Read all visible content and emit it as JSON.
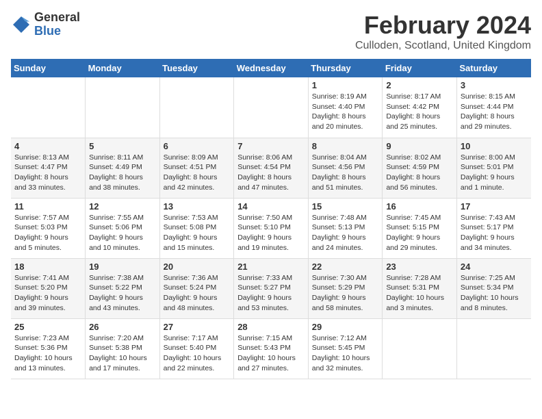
{
  "logo": {
    "general": "General",
    "blue": "Blue"
  },
  "title": "February 2024",
  "subtitle": "Culloden, Scotland, United Kingdom",
  "days_header": [
    "Sunday",
    "Monday",
    "Tuesday",
    "Wednesday",
    "Thursday",
    "Friday",
    "Saturday"
  ],
  "weeks": [
    [
      {
        "day": "",
        "info": ""
      },
      {
        "day": "",
        "info": ""
      },
      {
        "day": "",
        "info": ""
      },
      {
        "day": "",
        "info": ""
      },
      {
        "day": "1",
        "info": "Sunrise: 8:19 AM\nSunset: 4:40 PM\nDaylight: 8 hours\nand 20 minutes."
      },
      {
        "day": "2",
        "info": "Sunrise: 8:17 AM\nSunset: 4:42 PM\nDaylight: 8 hours\nand 25 minutes."
      },
      {
        "day": "3",
        "info": "Sunrise: 8:15 AM\nSunset: 4:44 PM\nDaylight: 8 hours\nand 29 minutes."
      }
    ],
    [
      {
        "day": "4",
        "info": "Sunrise: 8:13 AM\nSunset: 4:47 PM\nDaylight: 8 hours\nand 33 minutes."
      },
      {
        "day": "5",
        "info": "Sunrise: 8:11 AM\nSunset: 4:49 PM\nDaylight: 8 hours\nand 38 minutes."
      },
      {
        "day": "6",
        "info": "Sunrise: 8:09 AM\nSunset: 4:51 PM\nDaylight: 8 hours\nand 42 minutes."
      },
      {
        "day": "7",
        "info": "Sunrise: 8:06 AM\nSunset: 4:54 PM\nDaylight: 8 hours\nand 47 minutes."
      },
      {
        "day": "8",
        "info": "Sunrise: 8:04 AM\nSunset: 4:56 PM\nDaylight: 8 hours\nand 51 minutes."
      },
      {
        "day": "9",
        "info": "Sunrise: 8:02 AM\nSunset: 4:59 PM\nDaylight: 8 hours\nand 56 minutes."
      },
      {
        "day": "10",
        "info": "Sunrise: 8:00 AM\nSunset: 5:01 PM\nDaylight: 9 hours\nand 1 minute."
      }
    ],
    [
      {
        "day": "11",
        "info": "Sunrise: 7:57 AM\nSunset: 5:03 PM\nDaylight: 9 hours\nand 5 minutes."
      },
      {
        "day": "12",
        "info": "Sunrise: 7:55 AM\nSunset: 5:06 PM\nDaylight: 9 hours\nand 10 minutes."
      },
      {
        "day": "13",
        "info": "Sunrise: 7:53 AM\nSunset: 5:08 PM\nDaylight: 9 hours\nand 15 minutes."
      },
      {
        "day": "14",
        "info": "Sunrise: 7:50 AM\nSunset: 5:10 PM\nDaylight: 9 hours\nand 19 minutes."
      },
      {
        "day": "15",
        "info": "Sunrise: 7:48 AM\nSunset: 5:13 PM\nDaylight: 9 hours\nand 24 minutes."
      },
      {
        "day": "16",
        "info": "Sunrise: 7:45 AM\nSunset: 5:15 PM\nDaylight: 9 hours\nand 29 minutes."
      },
      {
        "day": "17",
        "info": "Sunrise: 7:43 AM\nSunset: 5:17 PM\nDaylight: 9 hours\nand 34 minutes."
      }
    ],
    [
      {
        "day": "18",
        "info": "Sunrise: 7:41 AM\nSunset: 5:20 PM\nDaylight: 9 hours\nand 39 minutes."
      },
      {
        "day": "19",
        "info": "Sunrise: 7:38 AM\nSunset: 5:22 PM\nDaylight: 9 hours\nand 43 minutes."
      },
      {
        "day": "20",
        "info": "Sunrise: 7:36 AM\nSunset: 5:24 PM\nDaylight: 9 hours\nand 48 minutes."
      },
      {
        "day": "21",
        "info": "Sunrise: 7:33 AM\nSunset: 5:27 PM\nDaylight: 9 hours\nand 53 minutes."
      },
      {
        "day": "22",
        "info": "Sunrise: 7:30 AM\nSunset: 5:29 PM\nDaylight: 9 hours\nand 58 minutes."
      },
      {
        "day": "23",
        "info": "Sunrise: 7:28 AM\nSunset: 5:31 PM\nDaylight: 10 hours\nand 3 minutes."
      },
      {
        "day": "24",
        "info": "Sunrise: 7:25 AM\nSunset: 5:34 PM\nDaylight: 10 hours\nand 8 minutes."
      }
    ],
    [
      {
        "day": "25",
        "info": "Sunrise: 7:23 AM\nSunset: 5:36 PM\nDaylight: 10 hours\nand 13 minutes."
      },
      {
        "day": "26",
        "info": "Sunrise: 7:20 AM\nSunset: 5:38 PM\nDaylight: 10 hours\nand 17 minutes."
      },
      {
        "day": "27",
        "info": "Sunrise: 7:17 AM\nSunset: 5:40 PM\nDaylight: 10 hours\nand 22 minutes."
      },
      {
        "day": "28",
        "info": "Sunrise: 7:15 AM\nSunset: 5:43 PM\nDaylight: 10 hours\nand 27 minutes."
      },
      {
        "day": "29",
        "info": "Sunrise: 7:12 AM\nSunset: 5:45 PM\nDaylight: 10 hours\nand 32 minutes."
      },
      {
        "day": "",
        "info": ""
      },
      {
        "day": "",
        "info": ""
      }
    ]
  ]
}
